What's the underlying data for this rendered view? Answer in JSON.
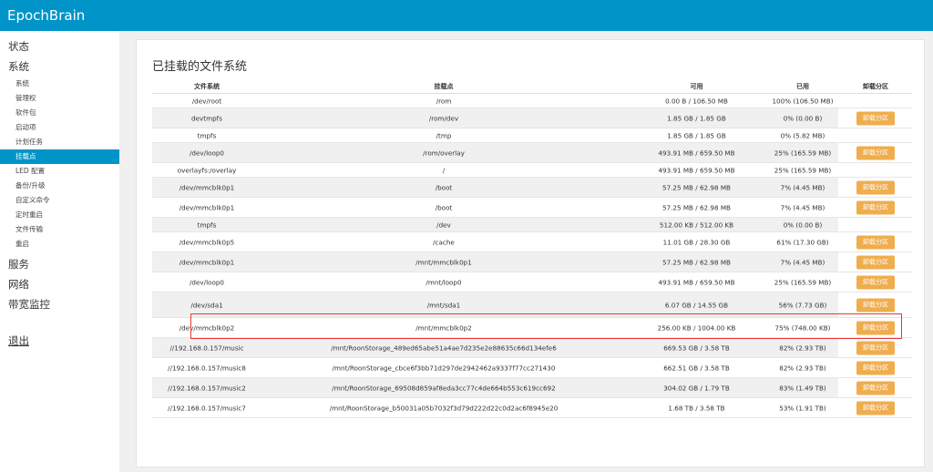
{
  "app": {
    "title": "EpochBrain"
  },
  "sidebar": {
    "status": "状态",
    "system": "系统",
    "sub_items": [
      {
        "label": "系统"
      },
      {
        "label": "管理权"
      },
      {
        "label": "软件包"
      },
      {
        "label": "启动项"
      },
      {
        "label": "计划任务"
      },
      {
        "label": "挂载点"
      },
      {
        "label": "LED 配置"
      },
      {
        "label": "备份/升级"
      },
      {
        "label": "自定义命令"
      },
      {
        "label": "定时重启"
      },
      {
        "label": "文件传输"
      },
      {
        "label": "重启"
      }
    ],
    "services": "服务",
    "network": "网络",
    "bandwidth": "带宽监控",
    "logout": "退出"
  },
  "main": {
    "title": "已挂载的文件系统",
    "columns": {
      "filesystem": "文件系统",
      "mountpoint": "挂载点",
      "available": "可用",
      "used": "已用",
      "unmount": "卸载分区"
    },
    "unmount_label": "卸载分区",
    "rows": [
      {
        "fs": "/dev/root",
        "mount": "/rom",
        "avail": "0.00 B / 106.50 MB",
        "used": "100% (106.50 MB)",
        "btn": false
      },
      {
        "fs": "devtmpfs",
        "mount": "/rom/dev",
        "avail": "1.85 GB / 1.85 GB",
        "used": "0% (0.00 B)",
        "btn": true
      },
      {
        "fs": "tmpfs",
        "mount": "/tmp",
        "avail": "1.85 GB / 1.85 GB",
        "used": "0% (5.82 MB)",
        "btn": false
      },
      {
        "fs": "/dev/loop0",
        "mount": "/rom/overlay",
        "avail": "493.91 MB / 659.50 MB",
        "used": "25% (165.59 MB)",
        "btn": true
      },
      {
        "fs": "overlayfs:/overlay",
        "mount": "/",
        "avail": "493.91 MB / 659.50 MB",
        "used": "25% (165.59 MB)",
        "btn": false
      },
      {
        "fs": "/dev/mmcblk0p1",
        "mount": "/boot",
        "avail": "57.25 MB / 62.98 MB",
        "used": "7% (4.45 MB)",
        "btn": true
      },
      {
        "fs": "/dev/mmcblk0p1",
        "mount": "/boot",
        "avail": "57.25 MB / 62.98 MB",
        "used": "7% (4.45 MB)",
        "btn": true
      },
      {
        "fs": "tmpfs",
        "mount": "/dev",
        "avail": "512.00 KB / 512.00 KB",
        "used": "0% (0.00 B)",
        "btn": false
      },
      {
        "fs": "/dev/mmcblk0p5",
        "mount": "/cache",
        "avail": "11.01 GB / 28.30 GB",
        "used": "61% (17.30 GB)",
        "btn": true
      },
      {
        "fs": "/dev/mmcblk0p1",
        "mount": "/mnt/mmcblk0p1",
        "avail": "57.25 MB / 62.98 MB",
        "used": "7% (4.45 MB)",
        "btn": true
      },
      {
        "fs": "/dev/loop0",
        "mount": "/mnt/loop0",
        "avail": "493.91 MB / 659.50 MB",
        "used": "25% (165.59 MB)",
        "btn": true
      },
      {
        "fs": "/dev/sda1",
        "mount": "/mnt/sda1",
        "avail": "6.07 GB / 14.55 GB",
        "used": "56% (7.73 GB)",
        "btn": true
      },
      {
        "fs": "/dev/mmcblk0p2",
        "mount": "/mnt/mmcblk0p2",
        "avail": "256.00 KB / 1004.00 KB",
        "used": "75% (748.00 KB)",
        "btn": true
      },
      {
        "fs": "//192.168.0.157/music",
        "mount": "/mnt/RoonStorage_489ed65abe51a4ae7d235e2e88635c66d134efe6",
        "avail": "669.53 GB / 3.58 TB",
        "used": "82% (2.93 TB)",
        "btn": true
      },
      {
        "fs": "//192.168.0.157/music8",
        "mount": "/mnt/RoonStorage_cbce6f3bb71d297de2942462a9337f77cc271430",
        "avail": "662.51 GB / 3.58 TB",
        "used": "82% (2.93 TB)",
        "btn": true
      },
      {
        "fs": "//192.168.0.157/music2",
        "mount": "/mnt/RoonStorage_69508d859af8eda3cc77c4de664b553c619cc692",
        "avail": "304.02 GB / 1.79 TB",
        "used": "83% (1.49 TB)",
        "btn": true
      },
      {
        "fs": "//192.168.0.157/music7",
        "mount": "/mnt/RoonStorage_b50031a05b7032f3d79d222d22c0d2ac6f8945e20",
        "avail": "1.68 TB / 3.58 TB",
        "used": "53% (1.91 TB)",
        "btn": true
      }
    ]
  }
}
